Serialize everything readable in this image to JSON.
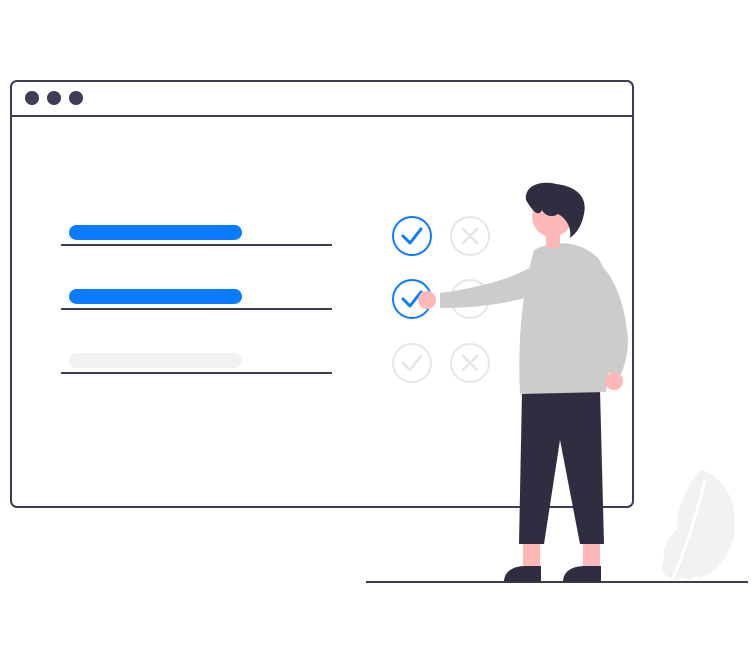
{
  "colors": {
    "frame": "#3f3d56",
    "accent": "#0a7cff",
    "disabled": "#e6e6e6",
    "shirt": "#cccccc",
    "skin": "#ffb8b8",
    "hair": "#2f2e41",
    "pants": "#2f2e41",
    "leaf": "#f2f2f2",
    "white": "#ffffff"
  },
  "window": {
    "controls": [
      "dot-1",
      "dot-2",
      "dot-3"
    ]
  },
  "rows": [
    {
      "filled": true,
      "check_active": true,
      "x_active": false
    },
    {
      "filled": true,
      "check_active": true,
      "x_active": false
    },
    {
      "filled": false,
      "check_active": false,
      "x_active": false
    }
  ],
  "icons": [
    "check-icon",
    "cross-icon",
    "window-dot-icon",
    "leaf-icon"
  ]
}
